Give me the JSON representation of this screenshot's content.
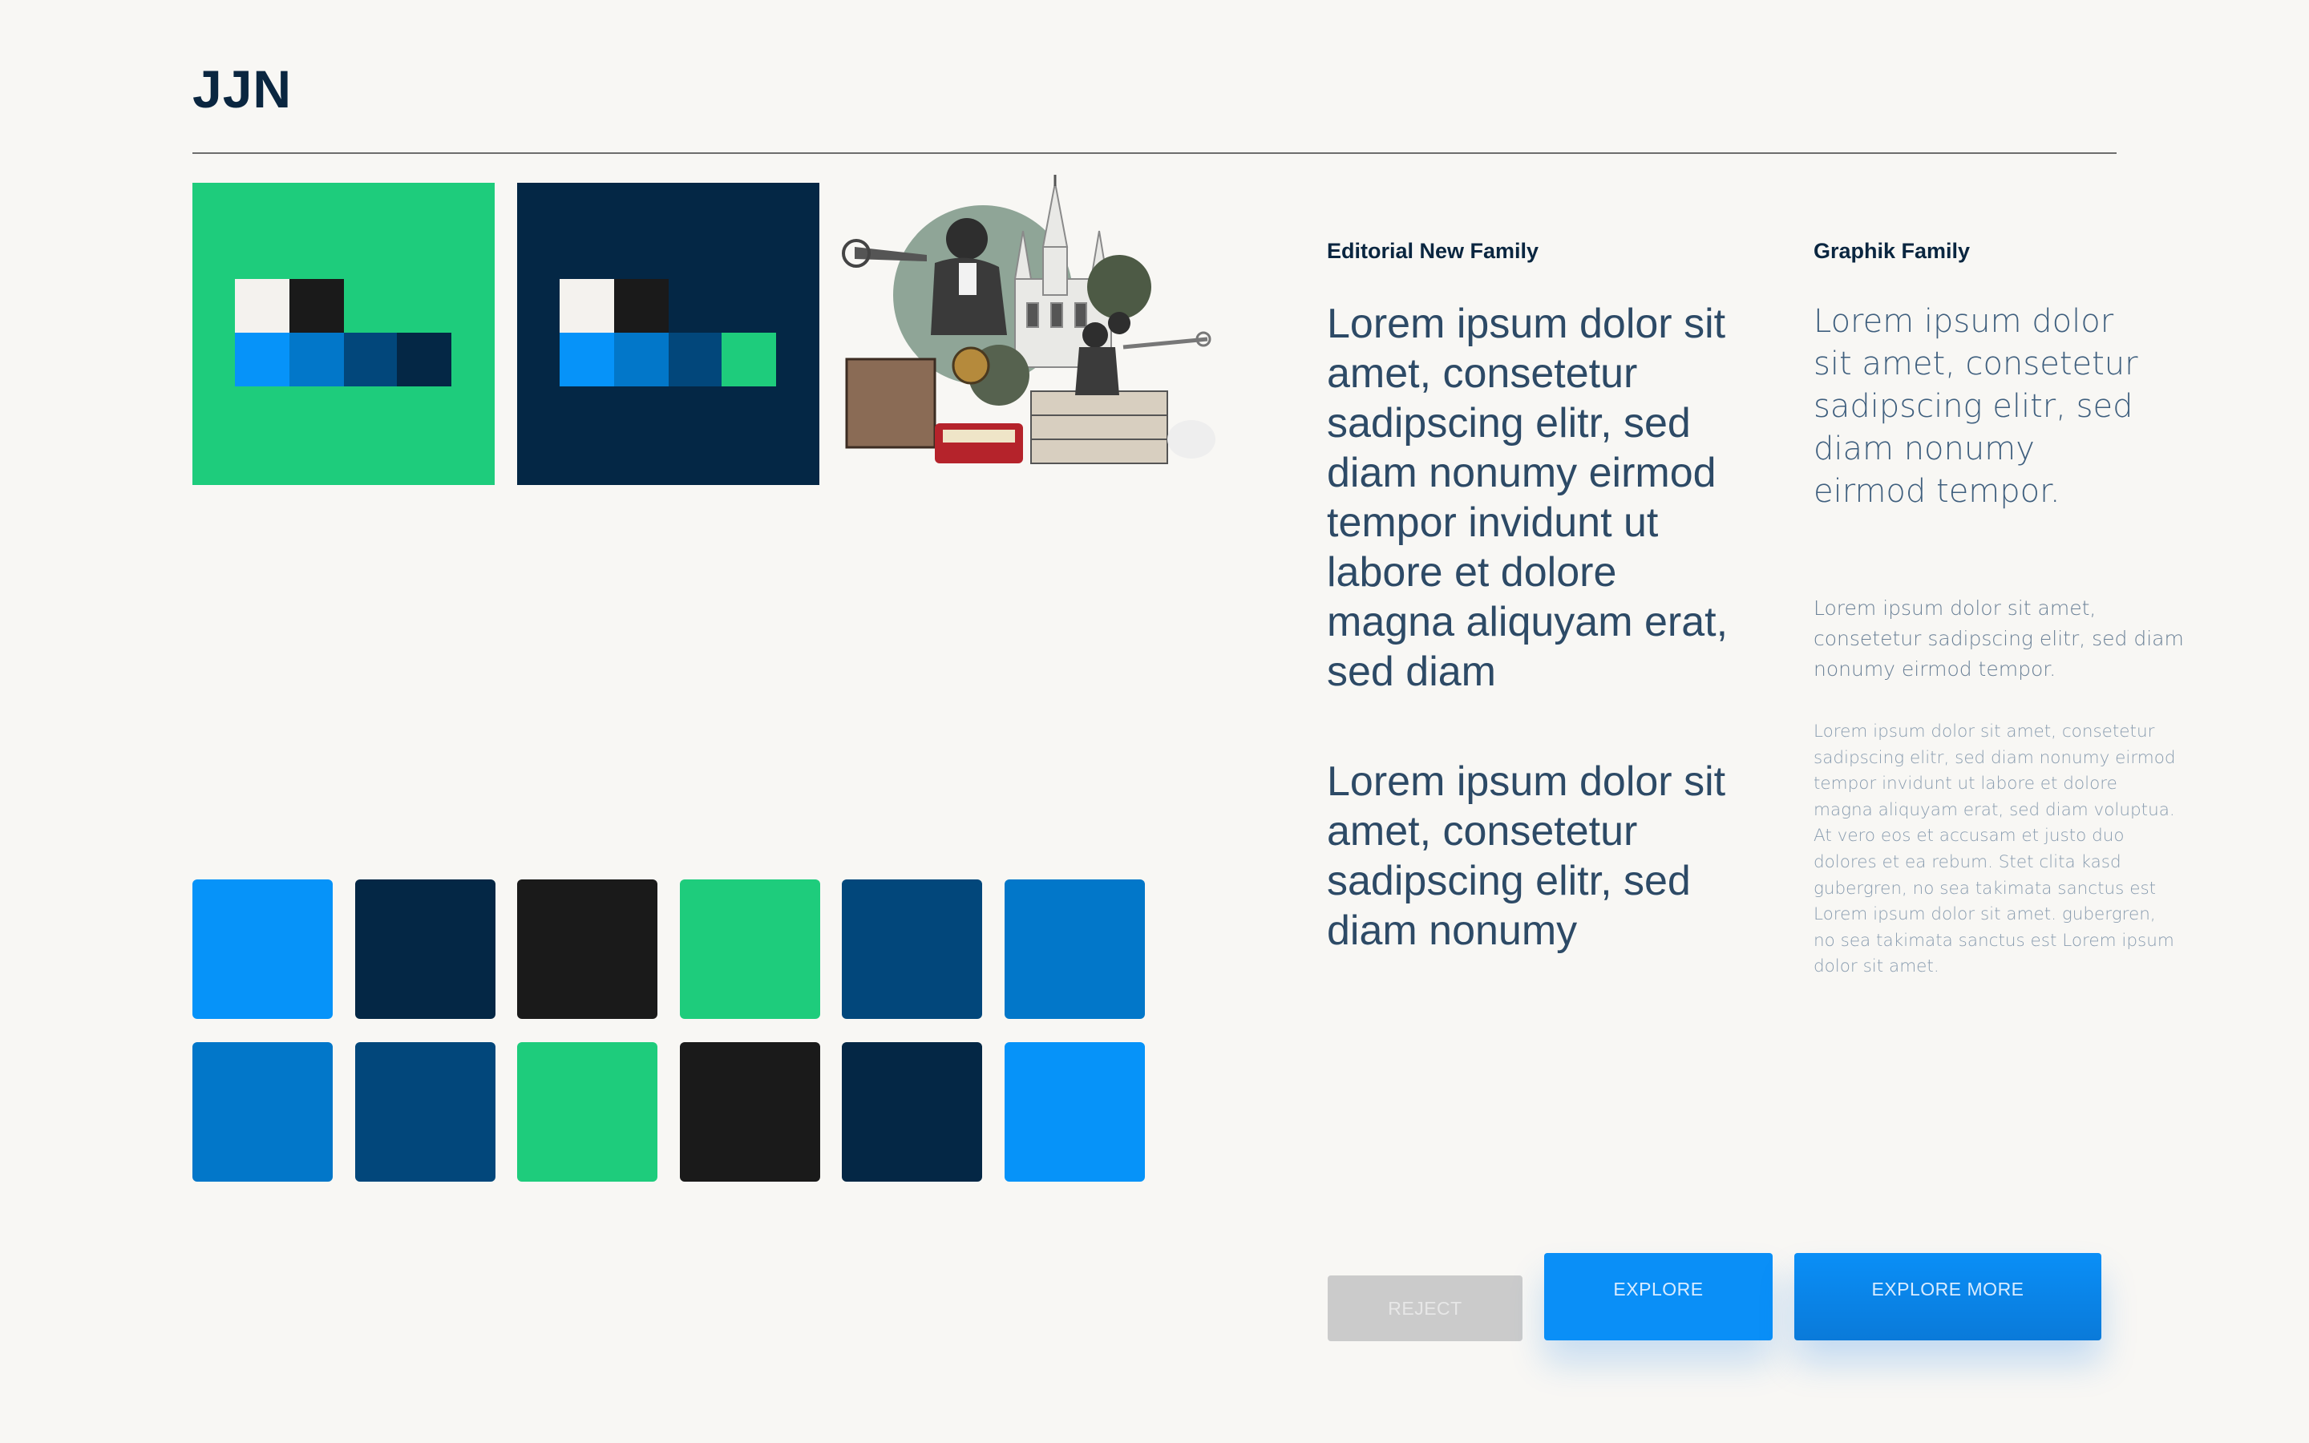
{
  "header": {
    "brand": "JJN"
  },
  "colors": {
    "background": "#f8f7f4",
    "green": "#1ecc7c",
    "navy": "#042745",
    "black": "#1a1a1a",
    "bright_blue": "#0693f9",
    "mid_blue": "#0277c9",
    "deep_blue": "#02477b",
    "white": "#f4f2ee"
  },
  "logos": [
    {
      "name": "logo-on-green",
      "accent_cell": "#042745"
    },
    {
      "name": "logo-on-navy",
      "accent_cell": "#1ecc7c"
    }
  ],
  "collage": {
    "description_icon": "new-orleans-collage-image"
  },
  "swatches": {
    "row1": [
      "#0693f9",
      "#042745",
      "#1a1a1a",
      "#1ecc7c",
      "#02477b",
      "#0277c9"
    ],
    "row2": [
      "#0277c9",
      "#02477b",
      "#1ecc7c",
      "#1a1a1a",
      "#042745",
      "#0693f9"
    ]
  },
  "typography": {
    "editorial": {
      "title": "Editorial New Family",
      "paragraph1": "Lorem ipsum dolor sit amet, consetetur sadipscing elitr, sed diam nonumy eirmod tempor invidunt ut labore et dolore magna aliquyam erat, sed diam",
      "paragraph2": "Lorem ipsum dolor sit amet, consetetur sadipscing elitr, sed diam nonumy"
    },
    "graphik": {
      "title": "Graphik Family",
      "large": "Lorem ipsum dolor sit amet, consetetur sadipscing elitr, sed diam nonumy eirmod tempor.",
      "medium": "Lorem ipsum dolor sit amet, consetetur sadipscing elitr, sed diam nonumy eirmod tempor.",
      "small": "Lorem ipsum dolor sit amet, consetetur sadipscing elitr, sed diam nonumy eirmod tempor invidunt ut labore et dolore magna aliquyam erat, sed diam voluptua. At vero eos et accusam et justo duo dolores et ea rebum. Stet clita kasd gubergren, no sea takimata sanctus est Lorem ipsum dolor sit amet. gubergren, no sea takimata sanctus est Lorem ipsum dolor sit amet."
    }
  },
  "buttons": {
    "reject": "REJECT",
    "explore": "EXPLORE",
    "explore_more": "EXPLORE MORE"
  }
}
